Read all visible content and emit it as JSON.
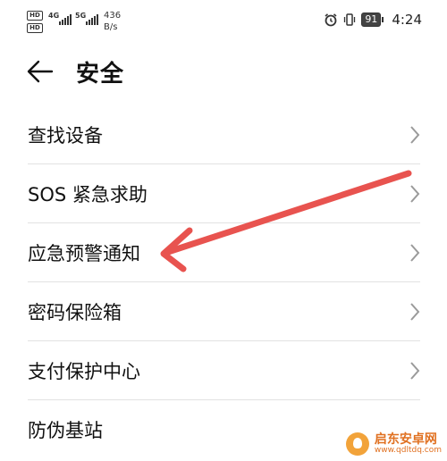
{
  "status_bar": {
    "hd1": "HD",
    "hd2": "HD",
    "net1": "4G",
    "net2": "5G",
    "speed_value": "436",
    "speed_unit": "B/s",
    "battery": "91",
    "time": "4:24",
    "icons": [
      "alarm-icon",
      "vibrate-icon",
      "battery-icon"
    ]
  },
  "header": {
    "title": "安全",
    "back_icon": "back-arrow-icon"
  },
  "menu": {
    "items": [
      {
        "label": "查找设备",
        "has_chevron": true
      },
      {
        "label": "SOS 紧急求助",
        "has_chevron": true
      },
      {
        "label": "应急预警通知",
        "has_chevron": true
      },
      {
        "label": "密码保险箱",
        "has_chevron": true
      },
      {
        "label": "支付保护中心",
        "has_chevron": true
      },
      {
        "label": "防伪基站",
        "has_chevron": false
      }
    ]
  },
  "annotation": {
    "color": "#e8534f"
  },
  "watermark": {
    "text": "启东安卓网",
    "url": "www.qdltdq.com"
  }
}
